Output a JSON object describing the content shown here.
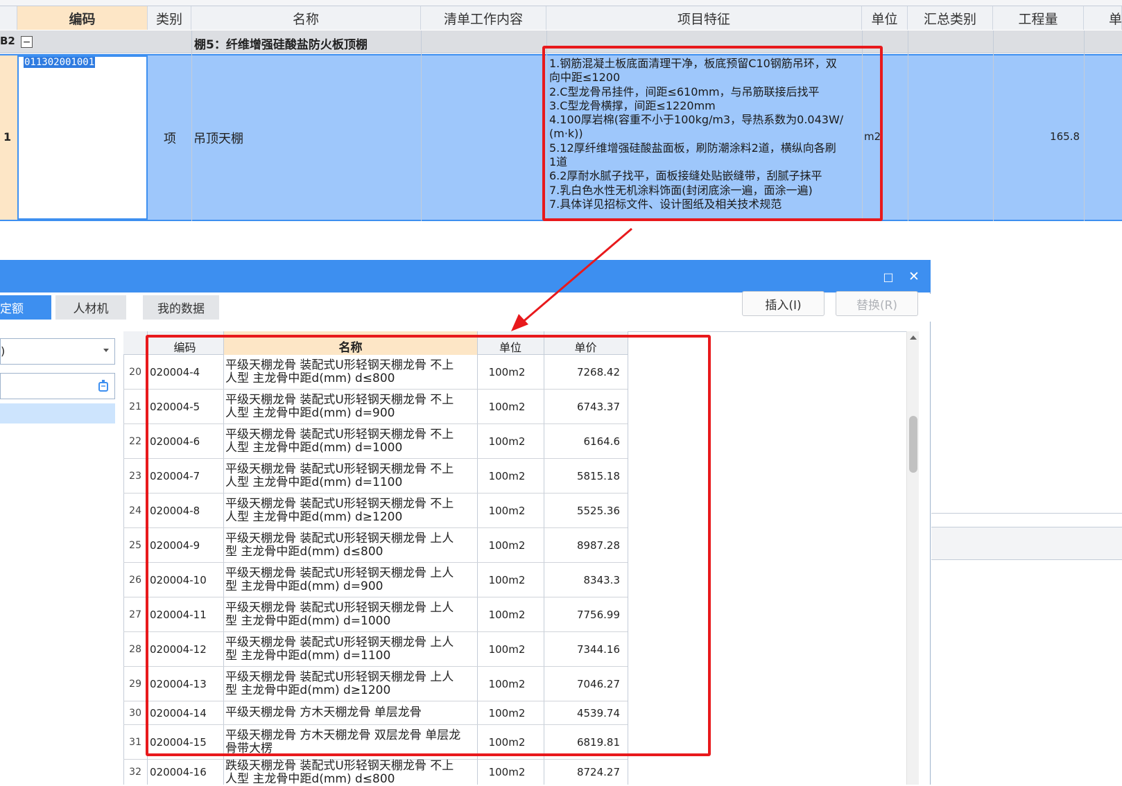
{
  "main_grid": {
    "headers": {
      "code": "编码",
      "type": "类别",
      "name": "名称",
      "work": "清单工作内容",
      "features": "项目特征",
      "unit": "单位",
      "summary": "汇总类别",
      "quantity": "工程量",
      "extra": "单"
    },
    "group_row": {
      "id": "B2",
      "toggle": "−",
      "title": "棚5：纤维增强硅酸盐防火板顶棚"
    },
    "item_row": {
      "index": "1",
      "code": "011302001001",
      "type": "项",
      "name": "吊顶天棚",
      "features": [
        "1.钢筋混凝土板底面清理干净，板底预留C10钢筋吊环，双",
        "向中距≤1200",
        "2.C型龙骨吊挂件，间距≤610mm，与吊筋联接后找平",
        "3.C型龙骨横撑，间距≤1220mm",
        "4.100厚岩棉(容重不小于100kg/m3，导热系数为0.043W/",
        "(m·k))",
        "5.12厚纤维增强硅酸盐面板，刷防潮涂料2道，横纵向各刷",
        "1道",
        "6.2厚耐水腻子找平，面板接缝处贴嵌缝带，刮腻子抹平",
        "7.乳白色水性无机涂料饰面(封闭底涂一遍，面涂一遍)",
        "7.具体详见招标文件、设计图纸及相关技术规范"
      ],
      "unit": "m2",
      "quantity": "165.8"
    }
  },
  "dialog": {
    "window_controls": {
      "maximize": "□",
      "close": "✕"
    },
    "tabs": [
      {
        "label": "定额"
      },
      {
        "label": "人材机"
      },
      {
        "label": "我的数据"
      }
    ],
    "buttons": {
      "insert": "插入(I)",
      "replace": "替换(R)"
    },
    "left_select_value": ")",
    "table": {
      "headers": {
        "code": "编码",
        "name": "名称",
        "unit": "单位",
        "price": "单价"
      },
      "rows": [
        {
          "idx": "20",
          "code": "020004-4",
          "name": "平级天棚龙骨 装配式U形轻钢天棚龙骨 不上人型 主龙骨中距d(mm) d≤800",
          "unit": "100m2",
          "price": "7268.42"
        },
        {
          "idx": "21",
          "code": "020004-5",
          "name": "平级天棚龙骨 装配式U形轻钢天棚龙骨 不上人型 主龙骨中距d(mm) d=900",
          "unit": "100m2",
          "price": "6743.37"
        },
        {
          "idx": "22",
          "code": "020004-6",
          "name": "平级天棚龙骨 装配式U形轻钢天棚龙骨 不上人型 主龙骨中距d(mm) d=1000",
          "unit": "100m2",
          "price": "6164.6"
        },
        {
          "idx": "23",
          "code": "020004-7",
          "name": "平级天棚龙骨 装配式U形轻钢天棚龙骨 不上人型 主龙骨中距d(mm) d=1100",
          "unit": "100m2",
          "price": "5815.18"
        },
        {
          "idx": "24",
          "code": "020004-8",
          "name": "平级天棚龙骨 装配式U形轻钢天棚龙骨 不上人型 主龙骨中距d(mm) d≥1200",
          "unit": "100m2",
          "price": "5525.36"
        },
        {
          "idx": "25",
          "code": "020004-9",
          "name": "平级天棚龙骨 装配式U形轻钢天棚龙骨 上人型 主龙骨中距d(mm) d≤800",
          "unit": "100m2",
          "price": "8987.28"
        },
        {
          "idx": "26",
          "code": "020004-10",
          "name": "平级天棚龙骨 装配式U形轻钢天棚龙骨 上人型 主龙骨中距d(mm) d=900",
          "unit": "100m2",
          "price": "8343.3"
        },
        {
          "idx": "27",
          "code": "020004-11",
          "name": "平级天棚龙骨 装配式U形轻钢天棚龙骨 上人型 主龙骨中距d(mm) d=1000",
          "unit": "100m2",
          "price": "7756.99"
        },
        {
          "idx": "28",
          "code": "020004-12",
          "name": "平级天棚龙骨 装配式U形轻钢天棚龙骨 上人型 主龙骨中距d(mm) d=1100",
          "unit": "100m2",
          "price": "7344.16"
        },
        {
          "idx": "29",
          "code": "020004-13",
          "name": "平级天棚龙骨 装配式U形轻钢天棚龙骨 上人型 主龙骨中距d(mm) d≥1200",
          "unit": "100m2",
          "price": "7046.27"
        },
        {
          "idx": "30",
          "code": "020004-14",
          "name": "平级天棚龙骨 方木天棚龙骨 单层龙骨",
          "unit": "100m2",
          "price": "4539.74"
        },
        {
          "idx": "31",
          "code": "020004-15",
          "name": "平级天棚龙骨 方木天棚龙骨 双层龙骨 单层龙骨带大楞",
          "unit": "100m2",
          "price": "6819.81"
        },
        {
          "idx": "32",
          "code": "020004-16",
          "name": "跌级天棚龙骨 装配式U形轻钢天棚龙骨 不上人型 主龙骨中距d(mm) d≤800",
          "unit": "100m2",
          "price": "8724.27"
        }
      ]
    }
  },
  "colors": {
    "selection_blue": "#9ec7fb",
    "dialog_title_blue": "#3d8ff0",
    "annotation_red": "#e8191c",
    "header_code_orange": "#fde6c6"
  }
}
